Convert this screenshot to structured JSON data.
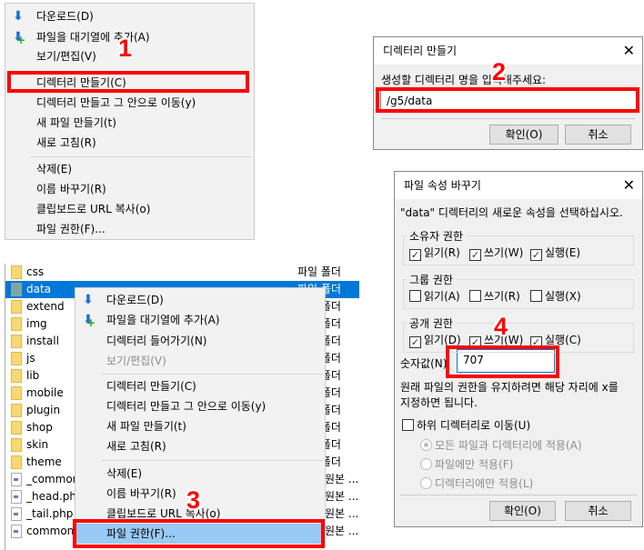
{
  "menu1": {
    "items": [
      {
        "label": "다운로드(D)",
        "icon": "download-icon"
      },
      {
        "label": "파일을 대기열에 추가(A)",
        "icon": "add-to-queue-icon"
      },
      {
        "label": "보기/편집(V)"
      },
      {
        "label": "디렉터리 만들기(C)"
      },
      {
        "label": "디렉터리 만들고 그 안으로 이동(y)"
      },
      {
        "label": "새 파일 만들기(t)"
      },
      {
        "label": "새로 고침(R)"
      },
      {
        "label": "삭제(E)"
      },
      {
        "label": "이름 바꾸기(R)"
      },
      {
        "label": "클립보드로 URL 복사(o)"
      },
      {
        "label": "파일 권한(F)..."
      }
    ]
  },
  "steps": [
    "1",
    "2",
    "3",
    "4"
  ],
  "mkdir_dialog": {
    "title": "디렉터리 만들기",
    "prompt": "생성할 디렉터리 명을 입력해주세요:",
    "value": "/g5/data",
    "ok": "확인(O)",
    "cancel": "취소"
  },
  "files": [
    {
      "name": "css",
      "type": "파일 폴더"
    },
    {
      "name": "data",
      "type": "파일 폴더",
      "selected": true
    },
    {
      "name": "extend",
      "type": "파일 폴더"
    },
    {
      "name": "img",
      "type": "파일 폴더"
    },
    {
      "name": "install",
      "type": "파일 폴더"
    },
    {
      "name": "js",
      "type": "파일 폴더"
    },
    {
      "name": "lib",
      "type": "파일 폴더"
    },
    {
      "name": "mobile",
      "type": "파일 폴더"
    },
    {
      "name": "plugin",
      "type": "파일 폴더"
    },
    {
      "name": "shop",
      "type": "파일 폴더"
    },
    {
      "name": "skin",
      "type": "파일 폴더"
    },
    {
      "name": "theme",
      "type": "파일 폴더"
    },
    {
      "name": "_common.php",
      "type": "원본 ..."
    },
    {
      "name": "_head.php",
      "type": "원본 ..."
    },
    {
      "name": "_tail.php",
      "type": "원본 ..."
    },
    {
      "name": "common.php",
      "type": "원본 ..."
    }
  ],
  "menu2": {
    "items": [
      {
        "label": "다운로드(D)",
        "icon": "download-icon"
      },
      {
        "label": "파일을 대기열에 추가(A)",
        "icon": "add-to-queue-icon"
      },
      {
        "label": "디렉터리 들어가기(N)"
      },
      {
        "label": "보기/편집(V)",
        "disabled": true
      },
      {
        "label": "디렉터리 만들기(C)"
      },
      {
        "label": "디렉터리 만들고 그 안으로 이동(y)"
      },
      {
        "label": "새 파일 만들기(t)"
      },
      {
        "label": "새로 고침(R)"
      },
      {
        "label": "삭제(E)"
      },
      {
        "label": "이름 바꾸기(R)"
      },
      {
        "label": "클립보드로 URL 복사(o)"
      },
      {
        "label": "파일 권한(F)...",
        "highlighted": true
      }
    ]
  },
  "perm_dialog": {
    "title": "파일 속성 바꾸기",
    "desc": "\"data\" 디렉터리의 새로운 속성을 선택하십시오.",
    "groups": [
      {
        "label": "소유자 권한",
        "checks": [
          {
            "label": "읽기(R)",
            "checked": true
          },
          {
            "label": "쓰기(W)",
            "checked": true
          },
          {
            "label": "실행(E)",
            "checked": true
          }
        ]
      },
      {
        "label": "그룹 권한",
        "checks": [
          {
            "label": "읽기(A)",
            "checked": false
          },
          {
            "label": "쓰기(R)",
            "checked": false
          },
          {
            "label": "실행(X)",
            "checked": false
          }
        ]
      },
      {
        "label": "공개 권한",
        "checks": [
          {
            "label": "읽기(D)",
            "checked": true
          },
          {
            "label": "쓰기(W)",
            "checked": true
          },
          {
            "label": "실행(C)",
            "checked": true
          }
        ]
      }
    ],
    "numeric_label": "숫자값(N)",
    "numeric_value": "707",
    "hint1": "원래 파일의 권한을 유지하려면 해당 자리에 x를",
    "hint2": "지정하면 됩니다.",
    "recurse_label": "하위 디렉터리로 이동(U)",
    "recurse_checked": false,
    "radios": [
      {
        "label": "모든 파일과 디렉터리에 적용(A)",
        "selected": true
      },
      {
        "label": "파일에만 적용(F)",
        "selected": false
      },
      {
        "label": "디렉터리에만 적용(L)",
        "selected": false
      }
    ],
    "ok": "확인(O)",
    "cancel": "취소"
  }
}
